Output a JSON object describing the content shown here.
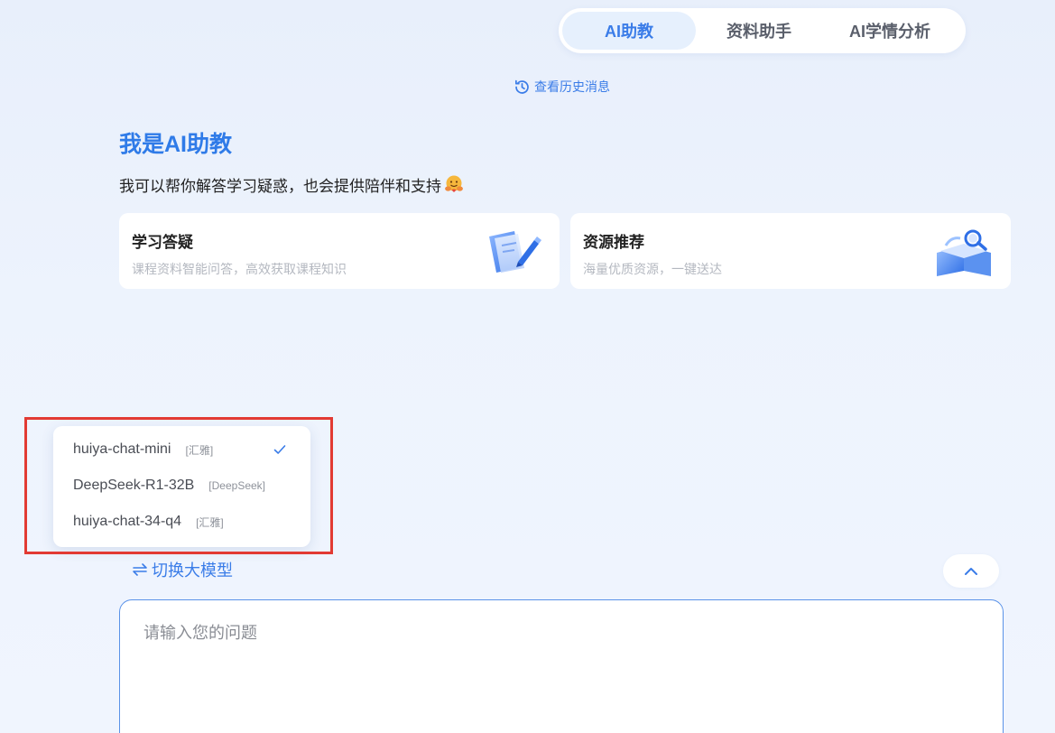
{
  "tabs": [
    {
      "label": "AI助教",
      "active": true
    },
    {
      "label": "资料助手",
      "active": false
    },
    {
      "label": "AI学情分析",
      "active": false
    }
  ],
  "history_link": {
    "label": "查看历史消息",
    "icon": "history-clock-icon"
  },
  "greeting": {
    "title": "我是AI助教",
    "subtitle": "我可以帮你解答学习疑惑，也会提供陪伴和支持",
    "emoji_icon": "hugging-face-icon"
  },
  "cards": [
    {
      "title": "学习答疑",
      "desc": "课程资料智能问答，高效获取课程知识",
      "icon": "notebook-pen-icon"
    },
    {
      "title": "资源推荐",
      "desc": "海量优质资源，一键送达",
      "icon": "open-book-search-icon"
    }
  ],
  "model_dropdown": {
    "options": [
      {
        "name": "huiya-chat-mini",
        "tag": "[汇雅]",
        "selected": true
      },
      {
        "name": "DeepSeek-R1-32B",
        "tag": "[DeepSeek]",
        "selected": false
      },
      {
        "name": "huiya-chat-34-q4",
        "tag": "[汇雅]",
        "selected": false
      }
    ]
  },
  "switch_model": {
    "label": "切换大模型"
  },
  "input": {
    "placeholder": "请输入您的问题",
    "value": ""
  },
  "colors": {
    "accent": "#3a7ce8",
    "highlight": "#e23a33",
    "background": "#edf3fd"
  }
}
